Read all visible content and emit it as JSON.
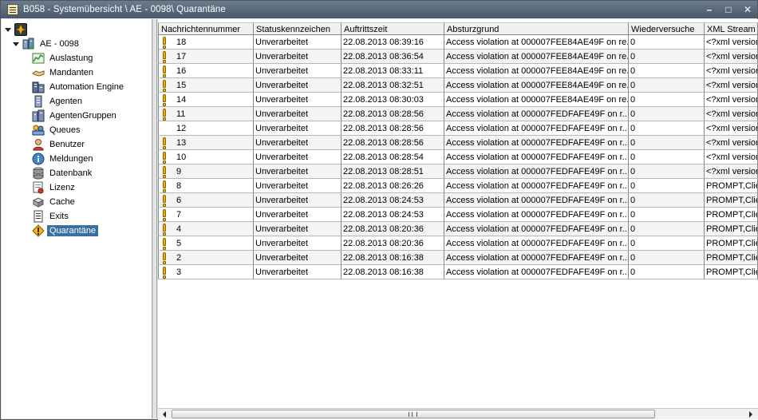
{
  "window": {
    "title": "B058 - Systemübersicht \\ AE - 0098\\ Quarantäne",
    "controls": [
      "–",
      "□",
      "✕"
    ]
  },
  "tree": {
    "server": "AE - 0098",
    "items": [
      {
        "label": "Auslastung",
        "icon": "chart-icon"
      },
      {
        "label": "Mandanten",
        "icon": "handshake-icon"
      },
      {
        "label": "Automation Engine",
        "icon": "building-icon"
      },
      {
        "label": "Agenten",
        "icon": "agent-icon"
      },
      {
        "label": "AgentenGruppen",
        "icon": "agent-group-icon"
      },
      {
        "label": "Queues",
        "icon": "queue-icon"
      },
      {
        "label": "Benutzer",
        "icon": "user-icon"
      },
      {
        "label": "Meldungen",
        "icon": "info-icon"
      },
      {
        "label": "Datenbank",
        "icon": "database-icon"
      },
      {
        "label": "Lizenz",
        "icon": "license-icon"
      },
      {
        "label": "Cache",
        "icon": "cache-icon"
      },
      {
        "label": "Exits",
        "icon": "exits-icon"
      },
      {
        "label": "Quarantäne",
        "icon": "warning-icon",
        "selected": true
      }
    ]
  },
  "table": {
    "columns": [
      "Nachrichtennummer",
      "Statuskennzeichen",
      "Auftrittszeit",
      "Absturzgrund",
      "Wiederversuche",
      "XML Stream"
    ],
    "rows": [
      {
        "warn": true,
        "num": "18",
        "status": "Unverarbeitet",
        "time": "22.08.2013 08:39:16",
        "reason": "Access violation at 000007FEE84AE49F on re...",
        "retries": "0",
        "xml": "<?xml version"
      },
      {
        "warn": true,
        "num": "17",
        "status": "Unverarbeitet",
        "time": "22.08.2013 08:36:54",
        "reason": "Access violation at 000007FEE84AE49F on re...",
        "retries": "0",
        "xml": "<?xml version"
      },
      {
        "warn": true,
        "num": "16",
        "status": "Unverarbeitet",
        "time": "22.08.2013 08:33:11",
        "reason": "Access violation at 000007FEE84AE49F on re...",
        "retries": "0",
        "xml": "<?xml version"
      },
      {
        "warn": true,
        "num": "15",
        "status": "Unverarbeitet",
        "time": "22.08.2013 08:32:51",
        "reason": "Access violation at 000007FEE84AE49F on re...",
        "retries": "0",
        "xml": "<?xml version"
      },
      {
        "warn": true,
        "num": "14",
        "status": "Unverarbeitet",
        "time": "22.08.2013 08:30:03",
        "reason": "Access violation at 000007FEE84AE49F on re...",
        "retries": "0",
        "xml": "<?xml version"
      },
      {
        "warn": true,
        "num": "11",
        "status": "Unverarbeitet",
        "time": "22.08.2013 08:28:56",
        "reason": "Access violation at 000007FEDFAFE49F on r...",
        "retries": "0",
        "xml": "<?xml version"
      },
      {
        "warn": false,
        "num": "12",
        "status": "Unverarbeitet",
        "time": "22.08.2013 08:28:56",
        "reason": "Access violation at 000007FEDFAFE49F on r...",
        "retries": "0",
        "xml": "<?xml version"
      },
      {
        "warn": true,
        "num": "13",
        "status": "Unverarbeitet",
        "time": "22.08.2013 08:28:56",
        "reason": "Access violation at 000007FEDFAFE49F on r...",
        "retries": "0",
        "xml": "<?xml version"
      },
      {
        "warn": true,
        "num": "10",
        "status": "Unverarbeitet",
        "time": "22.08.2013 08:28:54",
        "reason": "Access violation at 000007FEDFAFE49F on r...",
        "retries": "0",
        "xml": "<?xml version"
      },
      {
        "warn": true,
        "num": "9",
        "status": "Unverarbeitet",
        "time": "22.08.2013 08:28:51",
        "reason": "Access violation at 000007FEDFAFE49F on r...",
        "retries": "0",
        "xml": "<?xml version"
      },
      {
        "warn": true,
        "num": "8",
        "status": "Unverarbeitet",
        "time": "22.08.2013 08:26:26",
        "reason": "Access violation at 000007FEDFAFE49F on r...",
        "retries": "0",
        "xml": "PROMPT,Clien"
      },
      {
        "warn": true,
        "num": "6",
        "status": "Unverarbeitet",
        "time": "22.08.2013 08:24:53",
        "reason": "Access violation at 000007FEDFAFE49F on r...",
        "retries": "0",
        "xml": "PROMPT,Clien"
      },
      {
        "warn": true,
        "num": "7",
        "status": "Unverarbeitet",
        "time": "22.08.2013 08:24:53",
        "reason": "Access violation at 000007FEDFAFE49F on r...",
        "retries": "0",
        "xml": "PROMPT,Clien"
      },
      {
        "warn": true,
        "num": "4",
        "status": "Unverarbeitet",
        "time": "22.08.2013 08:20:36",
        "reason": "Access violation at 000007FEDFAFE49F on r...",
        "retries": "0",
        "xml": "PROMPT,Clien"
      },
      {
        "warn": true,
        "num": "5",
        "status": "Unverarbeitet",
        "time": "22.08.2013 08:20:36",
        "reason": "Access violation at 000007FEDFAFE49F on r...",
        "retries": "0",
        "xml": "PROMPT,Clien"
      },
      {
        "warn": true,
        "num": "2",
        "status": "Unverarbeitet",
        "time": "22.08.2013 08:16:38",
        "reason": "Access violation at 000007FEDFAFE49F on r...",
        "retries": "0",
        "xml": "PROMPT,Clien"
      },
      {
        "warn": true,
        "num": "3",
        "status": "Unverarbeitet",
        "time": "22.08.2013 08:16:38",
        "reason": "Access violation at 000007FEDFAFE49F on r...",
        "retries": "0",
        "xml": "PROMPT,Clien"
      }
    ]
  },
  "colors": {
    "selection": "#3b6ea5",
    "titlebar": "#4a5a6c",
    "warning": "#e8b000"
  }
}
